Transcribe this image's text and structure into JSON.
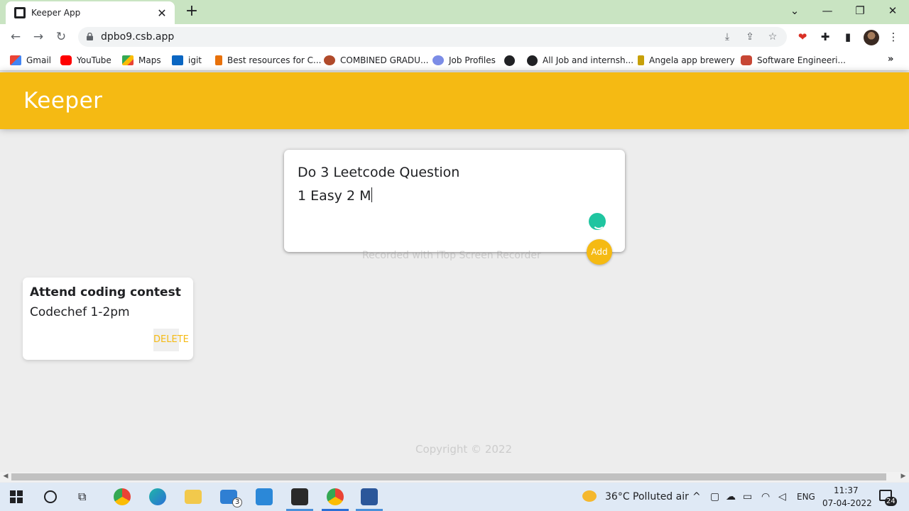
{
  "browser": {
    "tab_title": "Keeper App",
    "url": "dpbo9.csb.app"
  },
  "bookmarks": [
    {
      "label": "Gmail",
      "icon": "gmail-icon"
    },
    {
      "label": "YouTube",
      "icon": "youtube-icon"
    },
    {
      "label": "Maps",
      "icon": "maps-icon"
    },
    {
      "label": "igit",
      "icon": "linkedin-icon"
    },
    {
      "label": "Best resources for C...",
      "icon": "resource-icon"
    },
    {
      "label": "COMBINED GRADU...",
      "icon": "emblem-icon"
    },
    {
      "label": "Job Profiles",
      "icon": "swirl-icon"
    },
    {
      "label": "",
      "icon": "globe-icon"
    },
    {
      "label": "All Job and internsh...",
      "icon": "globe-icon"
    },
    {
      "label": "Angela app brewery",
      "icon": "brewery-icon"
    },
    {
      "label": "Software Engineeri...",
      "icon": "oracle-icon"
    }
  ],
  "app": {
    "title": "Keeper",
    "create": {
      "title_value": "Do 3 Leetcode Question",
      "content_value": "1 Easy 2 M",
      "add_label": "Add"
    },
    "watermark": "Recorded with iTop Screen Recorder",
    "notes": [
      {
        "title": "Attend coding contest",
        "content": "Codechef 1-2pm",
        "delete_label": "DELETE"
      }
    ],
    "footer": "Copyright © 2022"
  },
  "taskbar": {
    "mail_badge": "3",
    "weather": "36°C  Polluted air",
    "language": "ENG",
    "time": "11:37",
    "date": "07-04-2022",
    "notification_count": "24"
  },
  "colors": {
    "header": "#f5ba13",
    "tabstrip": "#c9e4c2",
    "background": "#ededed"
  }
}
